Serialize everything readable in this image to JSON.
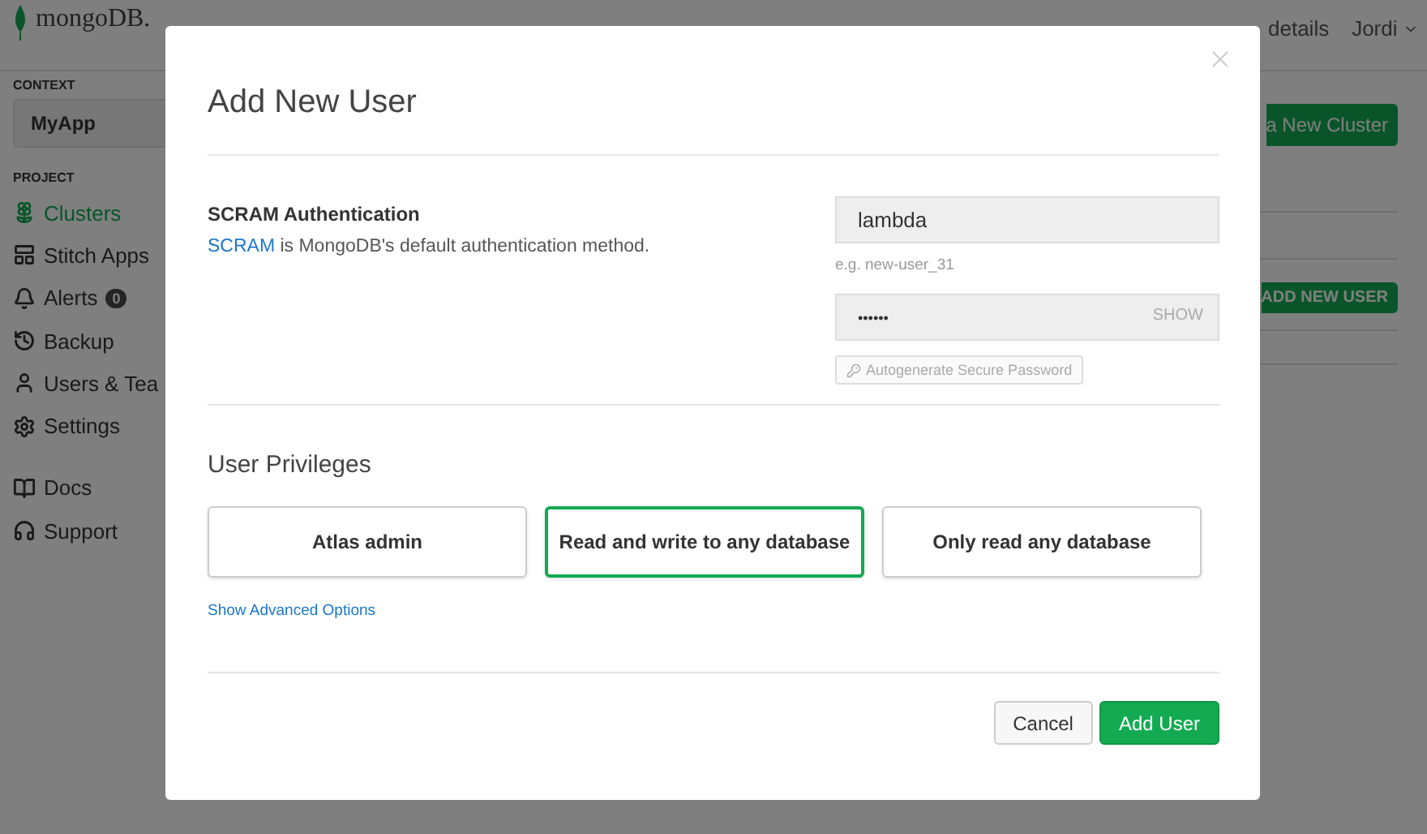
{
  "topbar": {
    "logo": "mongoDB.",
    "details_link": "details",
    "user": "Jordi"
  },
  "sidebar": {
    "context_label": "CONTEXT",
    "context_value": "MyApp",
    "project_label": "PROJECT",
    "items": [
      {
        "kind": "clusters",
        "label": "Clusters",
        "selected": true
      },
      {
        "kind": "apps",
        "label": "Stitch Apps",
        "selected": false
      },
      {
        "kind": "alerts",
        "label": "Alerts",
        "badge": "0",
        "selected": false
      },
      {
        "kind": "backup",
        "label": "Backup",
        "selected": false
      },
      {
        "kind": "users",
        "label": "Users & Tea",
        "selected": false
      },
      {
        "kind": "settings",
        "label": "Settings",
        "selected": false
      }
    ],
    "help_items": [
      {
        "kind": "docs",
        "label": "Docs"
      },
      {
        "kind": "support",
        "label": "Support"
      }
    ]
  },
  "background": {
    "primary_button": "a New Cluster",
    "add_button": "ADD NEW USER"
  },
  "modal": {
    "title": "Add New User",
    "auth": {
      "heading": "SCRAM Authentication",
      "link": "SCRAM",
      "description": " is MongoDB's default authentication method."
    },
    "username": {
      "value": "lambda",
      "hint": "e.g. new-user_31"
    },
    "password": {
      "value": "••••••",
      "toggle": "SHOW"
    },
    "autogenerate": "Autogenerate Secure Password",
    "privileges_title": "User Privileges",
    "privileges": [
      {
        "label": "Atlas admin",
        "selected": false
      },
      {
        "label": "Read and write to any database",
        "selected": true
      },
      {
        "label": "Only read any database",
        "selected": false
      }
    ],
    "advanced_link": "Show Advanced Options",
    "buttons": [
      {
        "kind": "secondary",
        "label": "Cancel"
      },
      {
        "kind": "primary",
        "label": "Add User"
      }
    ]
  }
}
